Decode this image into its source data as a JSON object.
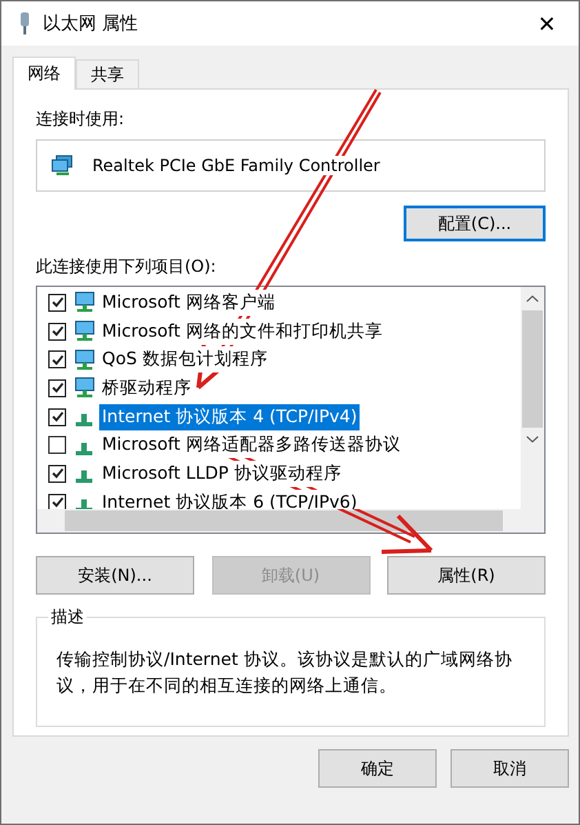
{
  "window": {
    "title": "以太网 属性",
    "close": "✕"
  },
  "tabs": [
    {
      "label": "网络",
      "selected": true
    },
    {
      "label": "共享",
      "selected": false
    }
  ],
  "connect_using": {
    "label": "连接时使用:",
    "adapter": "Realtek PCIe GbE Family Controller",
    "configure_button": "配置(C)..."
  },
  "items": {
    "label": "此连接使用下列项目(O):",
    "list": [
      {
        "label": "Microsoft 网络客户端",
        "kind": "service",
        "checked": true,
        "selected": false
      },
      {
        "label": "Microsoft 网络的文件和打印机共享",
        "kind": "service",
        "checked": true,
        "selected": false
      },
      {
        "label": "QoS 数据包计划程序",
        "kind": "service",
        "checked": true,
        "selected": false
      },
      {
        "label": "桥驱动程序",
        "kind": "service",
        "checked": true,
        "selected": false
      },
      {
        "label": "Internet 协议版本 4 (TCP/IPv4)",
        "kind": "protocol",
        "checked": true,
        "selected": true
      },
      {
        "label": "Microsoft 网络适配器多路传送器协议",
        "kind": "protocol",
        "checked": false,
        "selected": false
      },
      {
        "label": "Microsoft LLDP 协议驱动程序",
        "kind": "protocol",
        "checked": true,
        "selected": false
      },
      {
        "label": "Internet 协议版本 6 (TCP/IPv6)",
        "kind": "protocol",
        "checked": true,
        "selected": false
      }
    ]
  },
  "item_buttons": [
    {
      "label": "安装(N)...",
      "disabled": false
    },
    {
      "label": "卸载(U)",
      "disabled": true
    },
    {
      "label": "属性(R)",
      "disabled": false
    }
  ],
  "description": {
    "title": "描述",
    "text": "传输控制协议/Internet 协议。该协议是默认的广域网络协议，用于在不同的相互连接的网络上通信。"
  },
  "dialog_buttons": [
    {
      "label": "确定",
      "disabled": false
    },
    {
      "label": "取消",
      "disabled": false
    }
  ]
}
